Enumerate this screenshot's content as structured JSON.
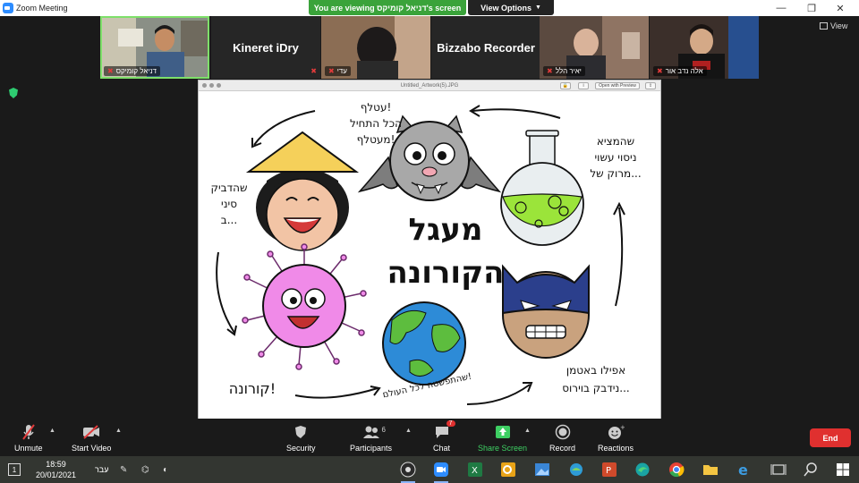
{
  "window": {
    "title": "Zoom Meeting",
    "banner_text": "You are viewing דניאל קומיקס's screen",
    "view_options_label": "View Options",
    "minimize": "—",
    "restore": "❐",
    "close": "✕"
  },
  "gallery": {
    "participants": [
      {
        "name": "דניאל קומיקס",
        "muted": true,
        "video": true
      },
      {
        "name": "Kineret iDry",
        "muted": true,
        "video": false
      },
      {
        "name": "עדי",
        "muted": true,
        "video": true
      },
      {
        "name": "Bizzabo Recorder",
        "muted": false,
        "video": false
      },
      {
        "name": "יאיר הלל",
        "muted": true,
        "video": true
      },
      {
        "name": "אלה נדב אור",
        "muted": true,
        "video": true
      }
    ],
    "view_label": "View"
  },
  "shared_window": {
    "file_title": "Untitled_Artwork(5).JPG",
    "open_with_label": "Open with Preview",
    "artwork": {
      "center_title_line1": "מעגל",
      "center_title_line2": "הקורונה",
      "notes": {
        "top": [
          "עטלף!",
          "הכל התחיל",
          "מעטלף!"
        ],
        "top_right": [
          "שהמציא",
          "ניסוי עשוי",
          "מרוק של..."
        ],
        "left": [
          "שהדביק",
          "סיני",
          "ב..."
        ],
        "bottom_left": "קורונה!",
        "bottom_center": "שהתפשטה לכל העולם!",
        "bottom_right": [
          "אפילו באטמן",
          "נידבק בוירוס..."
        ]
      }
    }
  },
  "toolbar": {
    "unmute": "Unmute",
    "start_video": "Start Video",
    "security": "Security",
    "participants": "Participants",
    "participants_count": "6",
    "chat": "Chat",
    "chat_badge": "7",
    "share_screen": "Share Screen",
    "record": "Record",
    "reactions": "Reactions",
    "end": "End"
  },
  "taskbar": {
    "time": "18:59",
    "date": "20/01/2021",
    "language": "עבר",
    "notifications": "1"
  },
  "colors": {
    "accent_green": "#3aa33a",
    "end_red": "#e0302f",
    "share_green": "#3ecf63"
  }
}
